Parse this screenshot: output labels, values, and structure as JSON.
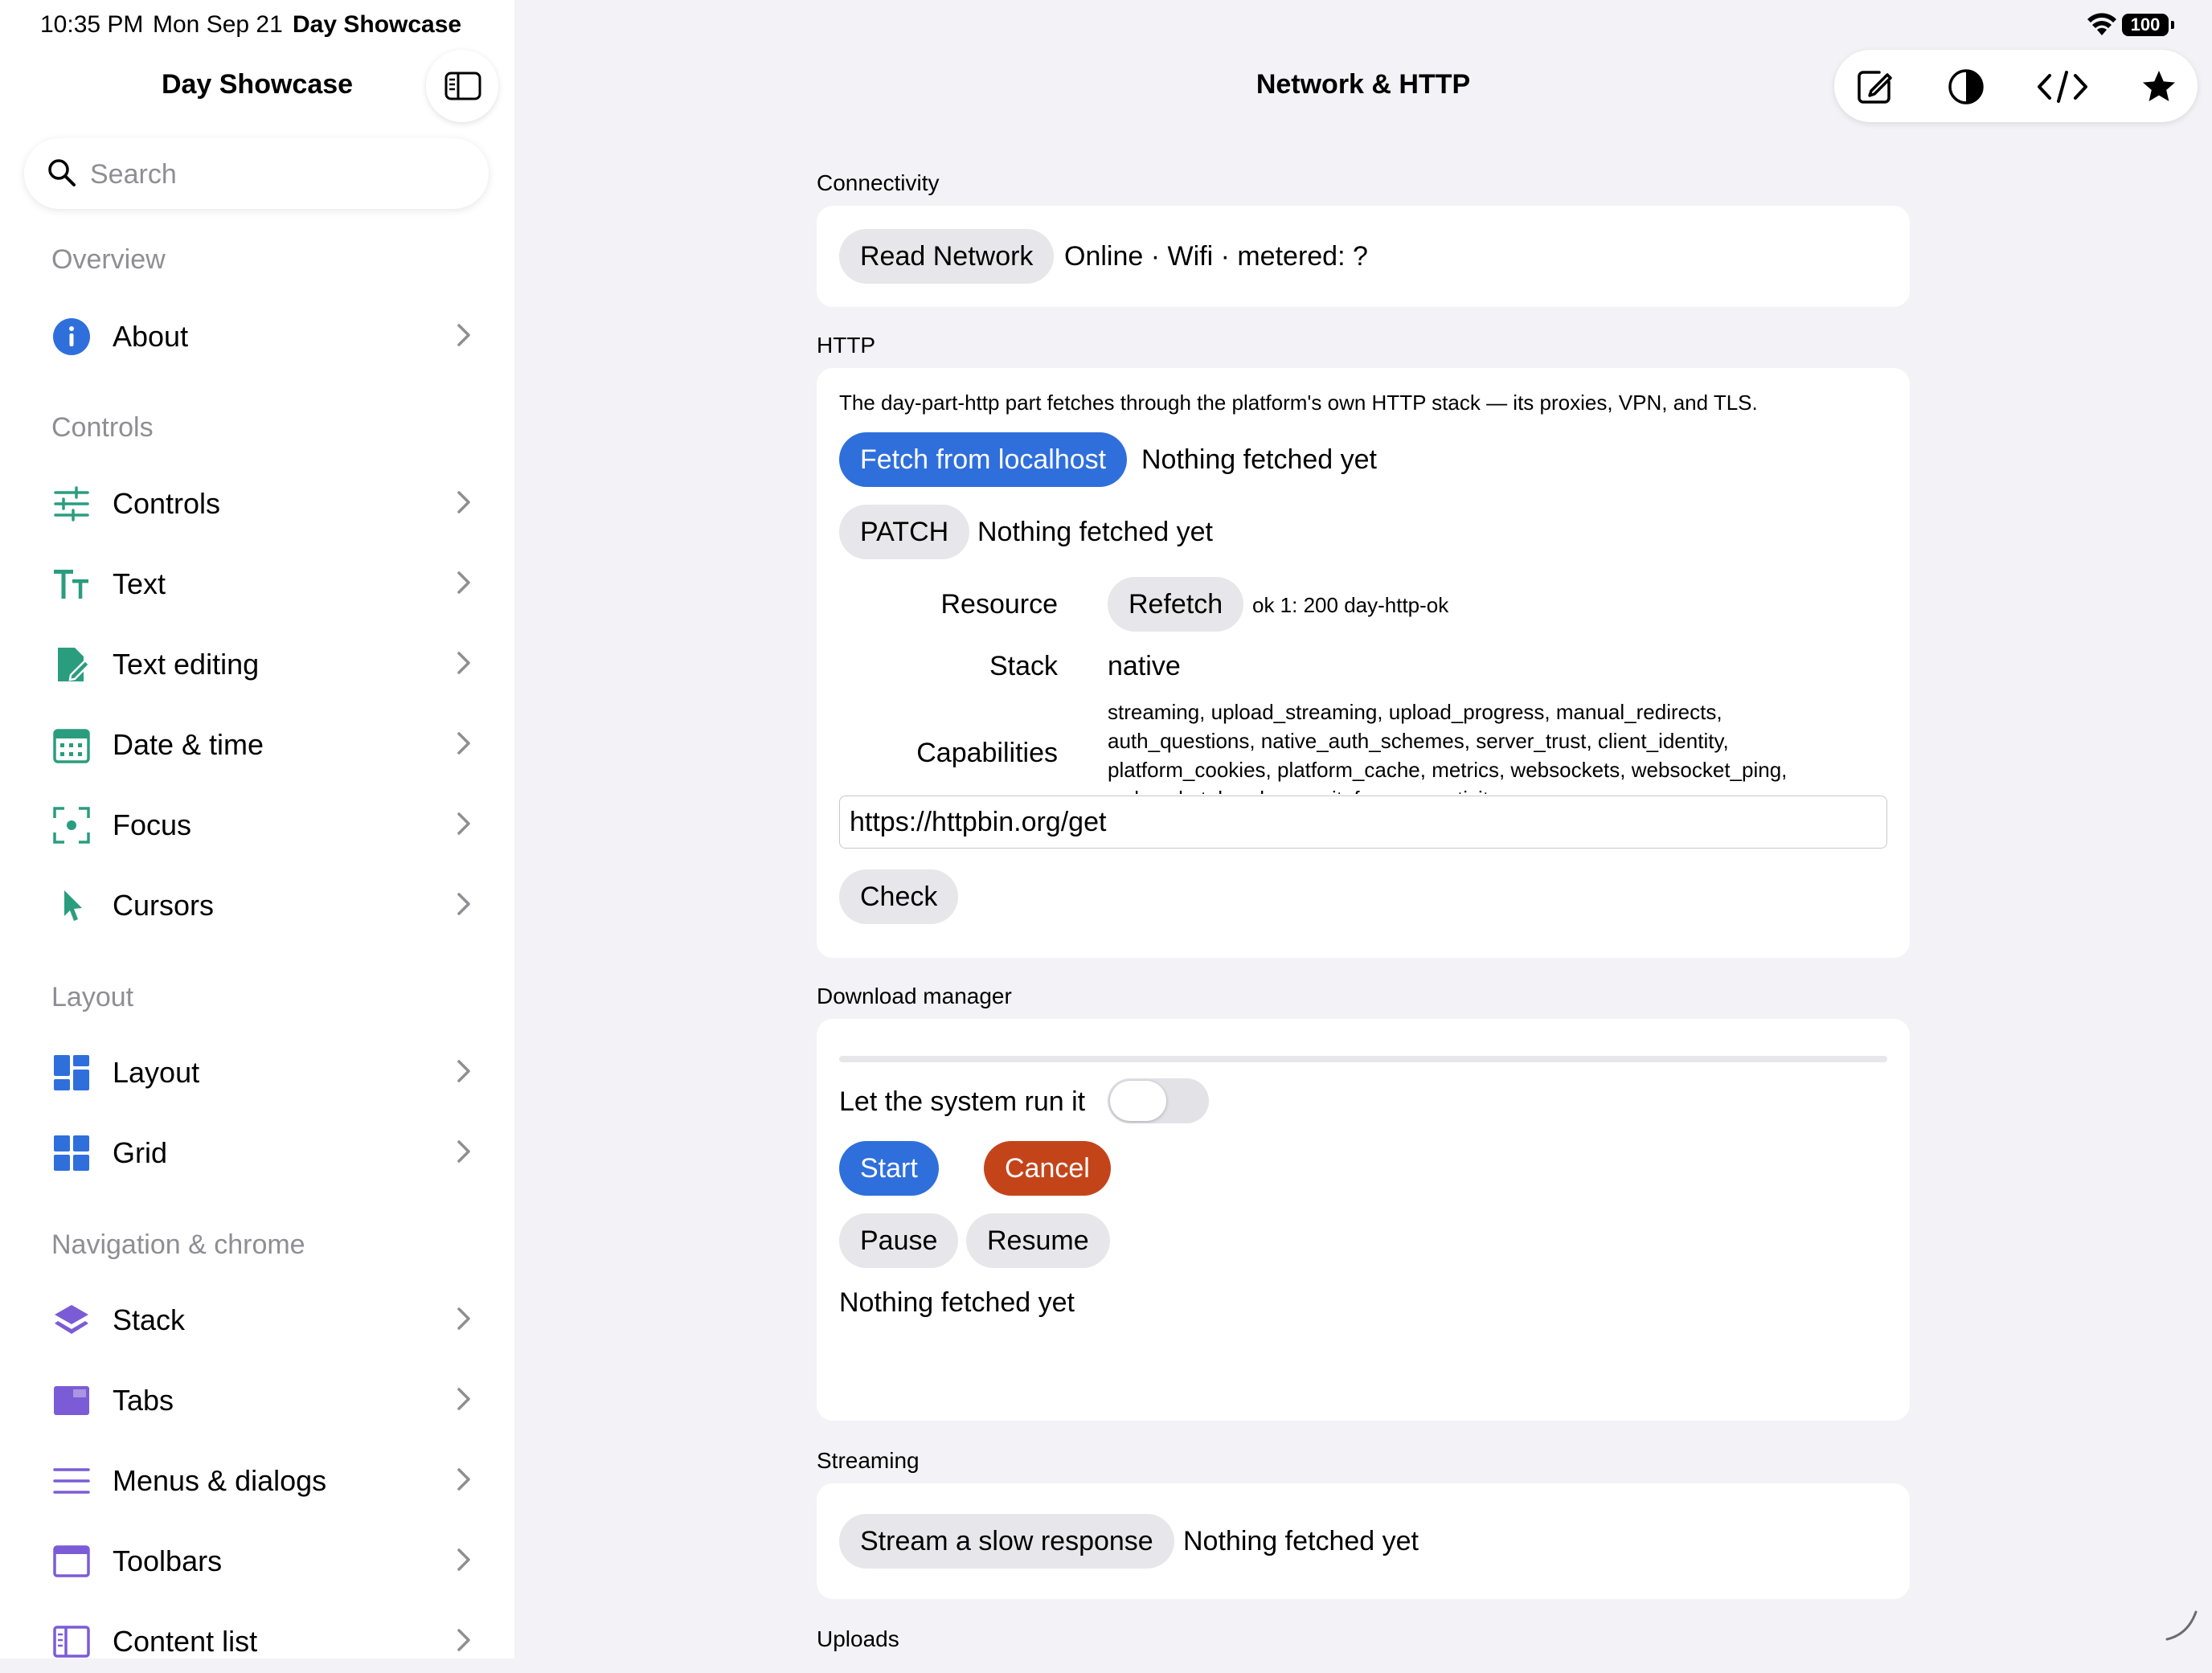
{
  "status_bar": {
    "time": "10:35 PM",
    "date": "Mon Sep 21",
    "app": "Day Showcase",
    "battery": "100"
  },
  "sidebar": {
    "title": "Day Showcase",
    "search_placeholder": "Search",
    "sections": [
      {
        "header": "Overview",
        "items": [
          {
            "label": "About",
            "icon": "info-icon"
          }
        ]
      },
      {
        "header": "Controls",
        "items": [
          {
            "label": "Controls",
            "icon": "sliders-icon"
          },
          {
            "label": "Text",
            "icon": "text-size-icon"
          },
          {
            "label": "Text editing",
            "icon": "document-edit-icon"
          },
          {
            "label": "Date & time",
            "icon": "calendar-icon"
          },
          {
            "label": "Focus",
            "icon": "focus-icon"
          },
          {
            "label": "Cursors",
            "icon": "cursor-icon"
          }
        ]
      },
      {
        "header": "Layout",
        "items": [
          {
            "label": "Layout",
            "icon": "layout-icon"
          },
          {
            "label": "Grid",
            "icon": "grid-icon"
          }
        ]
      },
      {
        "header": "Navigation & chrome",
        "items": [
          {
            "label": "Stack",
            "icon": "stack-icon"
          },
          {
            "label": "Tabs",
            "icon": "tabs-icon"
          },
          {
            "label": "Menus & dialogs",
            "icon": "menu-icon"
          },
          {
            "label": "Toolbars",
            "icon": "toolbar-icon"
          },
          {
            "label": "Content list",
            "icon": "content-list-icon"
          }
        ]
      }
    ]
  },
  "main": {
    "title": "Network & HTTP",
    "toolbar_icons": [
      "compose-icon",
      "contrast-icon",
      "code-icon",
      "star-icon"
    ],
    "connectivity": {
      "label": "Connectivity",
      "button": "Read Network",
      "status": "Online · Wifi · metered: ?"
    },
    "http": {
      "label": "HTTP",
      "description": "The day-part-http part fetches through the platform's own HTTP stack — its proxies, VPN, and TLS.",
      "fetch_button": "Fetch from localhost",
      "fetch_status": "Nothing fetched yet",
      "patch_button": "PATCH",
      "patch_status": "Nothing fetched yet",
      "resource_label": "Resource",
      "refetch_button": "Refetch",
      "resource_status": "ok 1: 200 day-http-ok",
      "stack_label": "Stack",
      "stack_value": "native",
      "capabilities_label": "Capabilities",
      "capabilities_value": "streaming, upload_streaming, upload_progress, manual_redirects, auth_questions, native_auth_schemes, server_trust, client_identity, platform_cookies, platform_cache, metrics, websockets, websocket_ping, websocket_headers, wait_for_connectivity",
      "url_value": "https://httpbin.org/get",
      "check_button": "Check"
    },
    "download": {
      "label": "Download manager",
      "progress": 0,
      "toggle_label": "Let the system run it",
      "toggle_on": false,
      "start_button": "Start",
      "cancel_button": "Cancel",
      "pause_button": "Pause",
      "resume_button": "Resume",
      "status": "Nothing fetched yet"
    },
    "streaming": {
      "label": "Streaming",
      "button": "Stream a slow response",
      "status": "Nothing fetched yet"
    },
    "uploads": {
      "label": "Uploads"
    }
  },
  "colors": {
    "accent_blue": "#2f6fdc",
    "cancel_red": "#c4441a",
    "icon_teal": "#2a9d7f",
    "icon_blue": "#2f6fdc",
    "icon_purple": "#7b5cd6"
  }
}
